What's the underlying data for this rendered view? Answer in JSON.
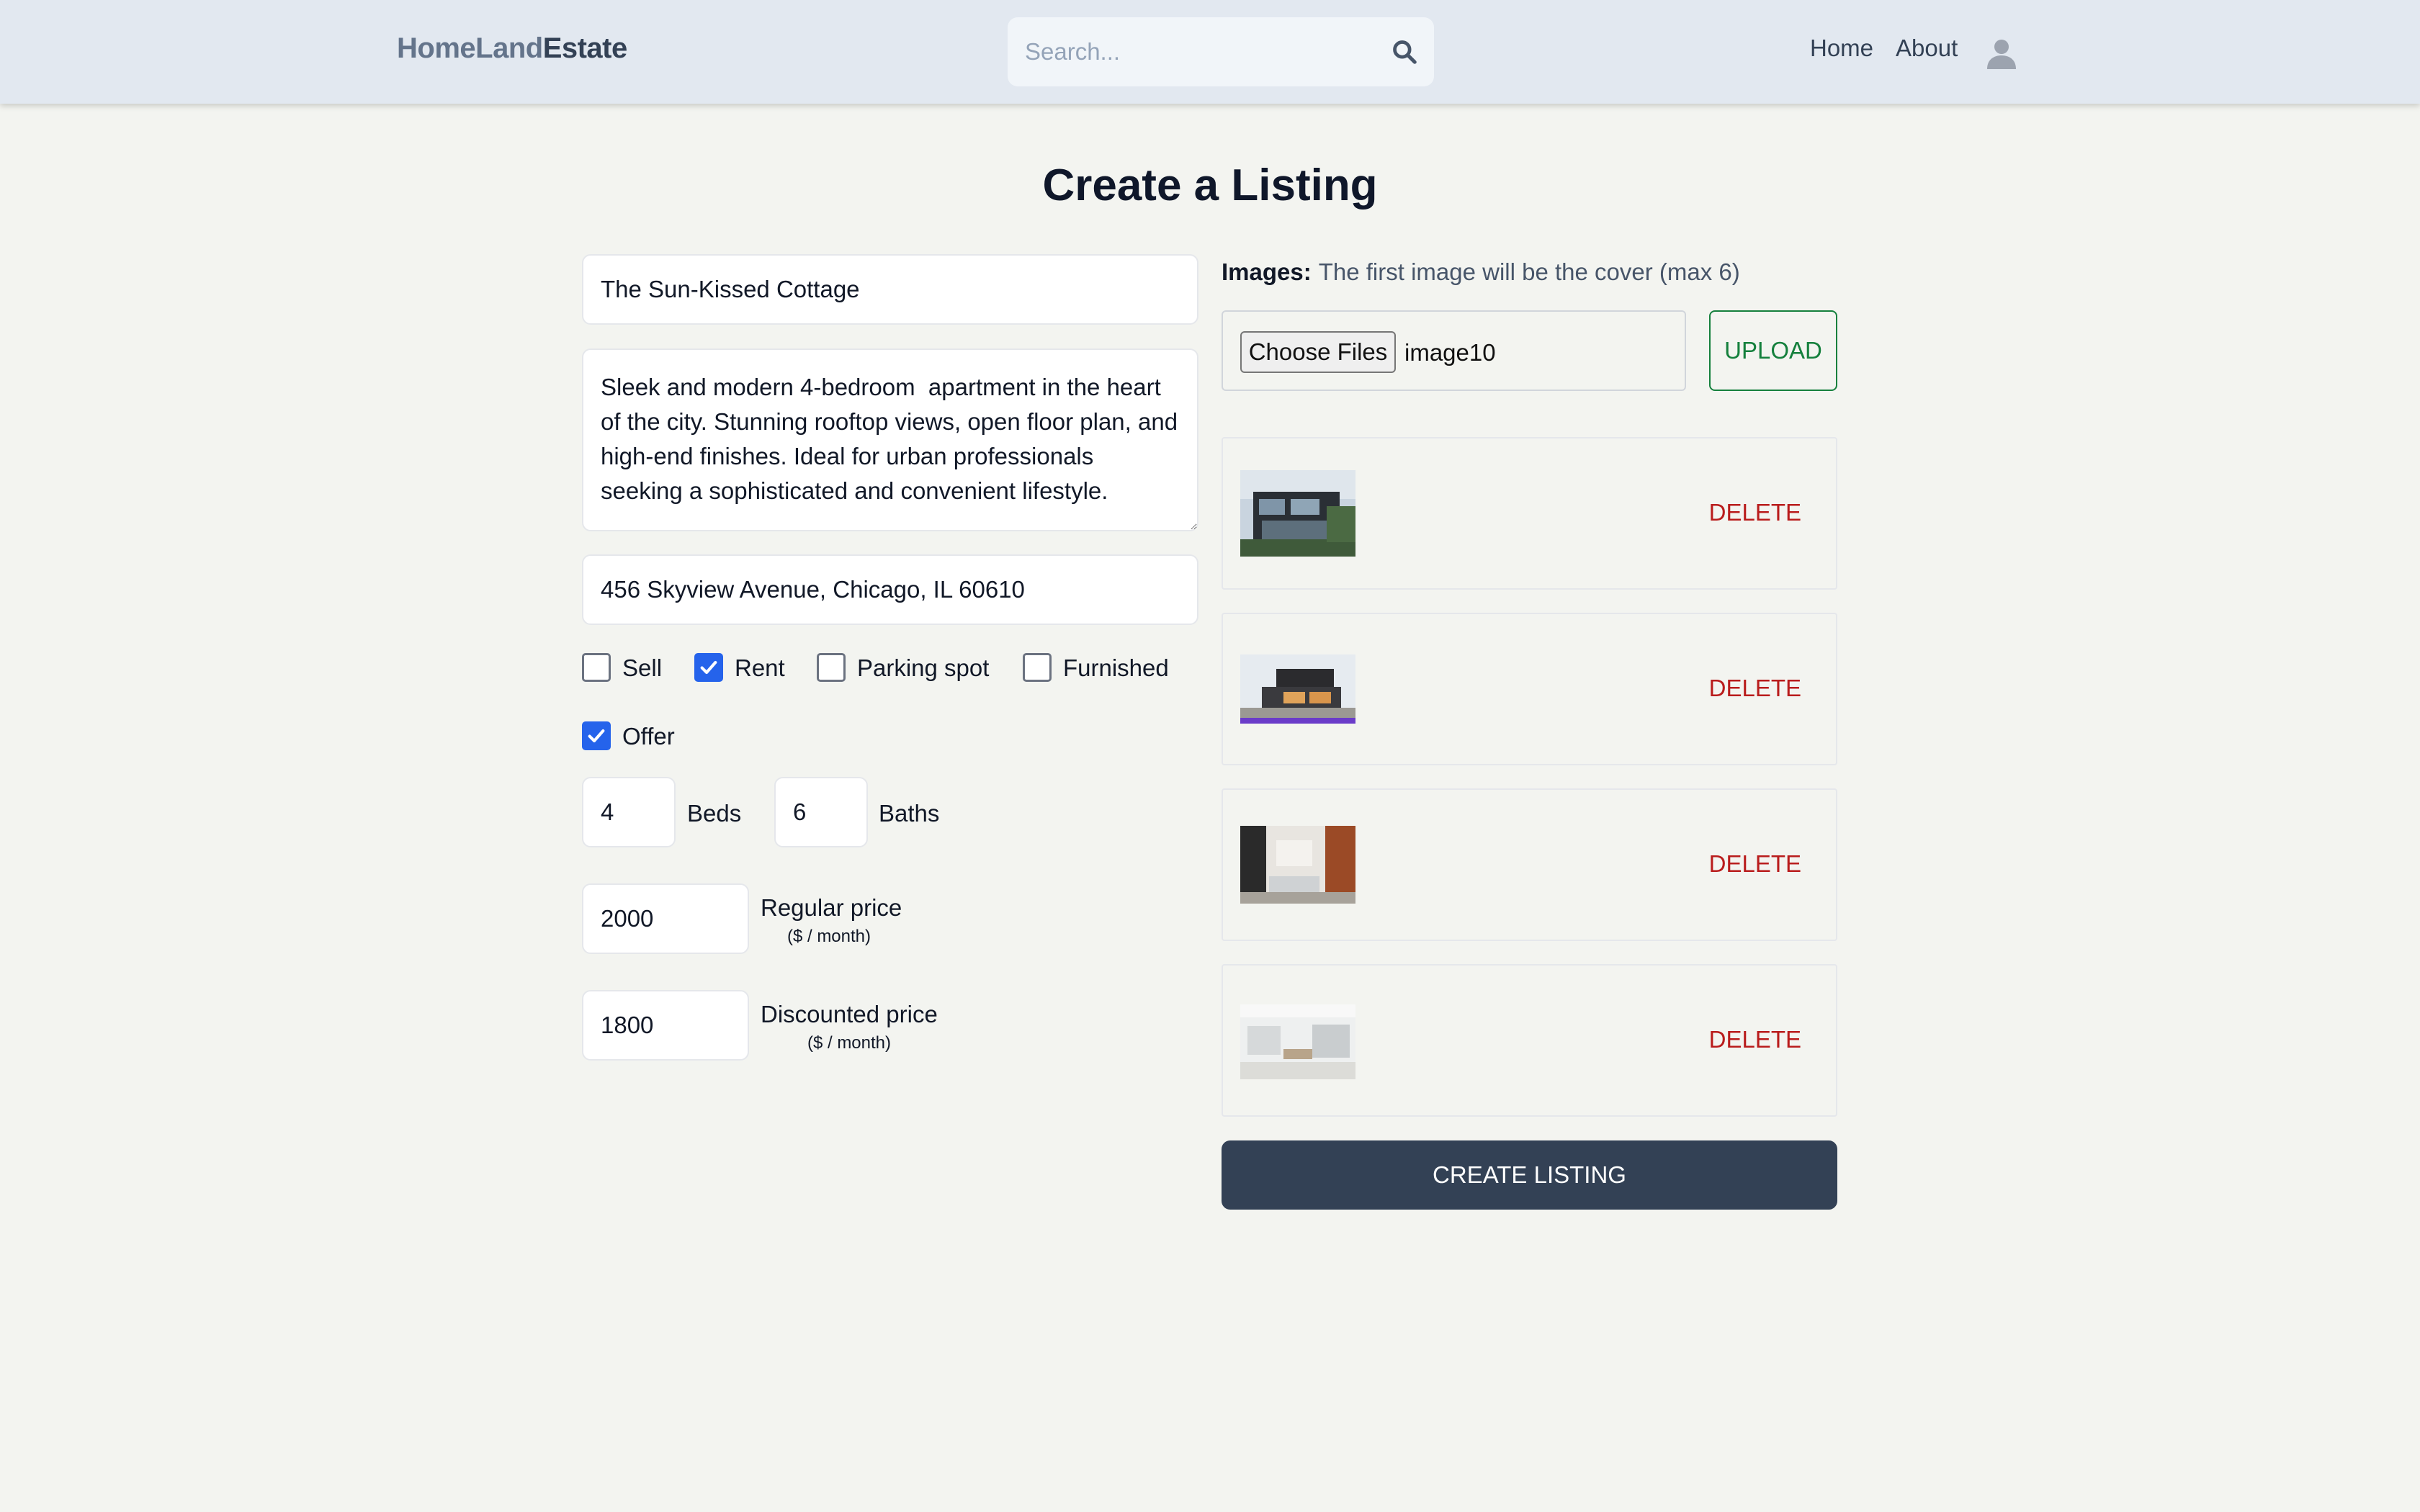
{
  "header": {
    "logo_part1": "HomeLand",
    "logo_part2": "Estate",
    "search_placeholder": "Search...",
    "nav": {
      "home": "Home",
      "about": "About"
    }
  },
  "page": {
    "title": "Create a Listing"
  },
  "form": {
    "name": "The Sun-Kissed Cottage",
    "description": "Sleek and modern 4-bedroom  apartment in the heart of the city. Stunning rooftop views, open floor plan, and high-end finishes. Ideal for urban professionals seeking a sophisticated and convenient lifestyle.",
    "address": "456 Skyview Avenue, Chicago, IL 60610",
    "options": {
      "sell": {
        "label": "Sell",
        "checked": false
      },
      "rent": {
        "label": "Rent",
        "checked": true
      },
      "parking": {
        "label": "Parking spot",
        "checked": false
      },
      "furnished": {
        "label": "Furnished",
        "checked": false
      },
      "offer": {
        "label": "Offer",
        "checked": true
      }
    },
    "beds": {
      "value": "4",
      "label": "Beds"
    },
    "baths": {
      "value": "6",
      "label": "Baths"
    },
    "regular_price": {
      "value": "2000",
      "label": "Regular price",
      "unit": "($ / month)"
    },
    "discounted_price": {
      "value": "1800",
      "label": "Discounted price",
      "unit": "($ / month)"
    }
  },
  "images": {
    "label": "Images:",
    "note": "The first image will be the cover (max 6)",
    "choose_files_label": "Choose Files",
    "selected_file": "image10",
    "upload_label": "UPLOAD",
    "delete_label": "DELETE",
    "items": [
      "house-exterior-1",
      "house-exterior-2",
      "interior-living-room",
      "interior-white-kitchen"
    ]
  },
  "submit": {
    "label": "CREATE LISTING"
  },
  "colors": {
    "header_bg": "#e2e8f0",
    "page_bg": "#f3f4f0",
    "accent_checkbox": "#2563eb",
    "upload_green": "#15803d",
    "delete_red": "#b91c1c",
    "primary_button": "#334155"
  }
}
